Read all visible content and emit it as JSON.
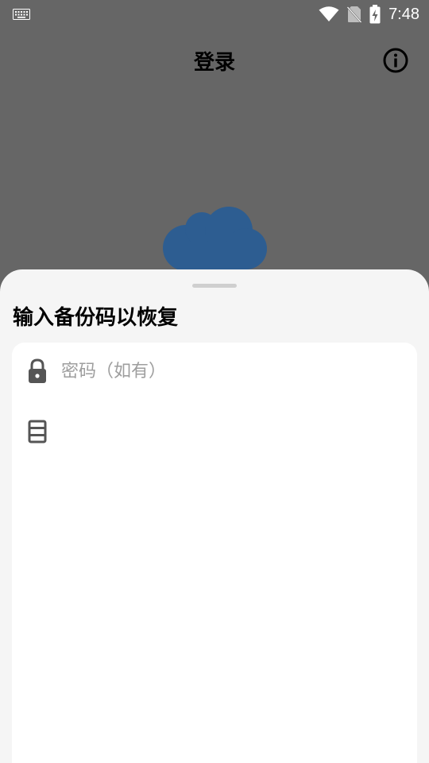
{
  "status_bar": {
    "time": "7:48",
    "icons": [
      "keyboard-icon",
      "wifi-icon",
      "no-sim-icon",
      "battery-charging-icon"
    ]
  },
  "app_bar": {
    "title": "登录",
    "info_icon": "info-icon"
  },
  "logo": {
    "icon": "cloud-icon",
    "color": "#2d5d91"
  },
  "sheet": {
    "title": "输入备份码以恢复",
    "password_field": {
      "icon": "lock-icon",
      "placeholder": "密码（如有）",
      "value": ""
    },
    "backup_code_field": {
      "icon": "database-icon",
      "placeholder": "",
      "value": ""
    }
  },
  "colors": {
    "scrim_background": "#666666",
    "sheet_background": "#f5f5f5",
    "card_background": "#ffffff"
  }
}
